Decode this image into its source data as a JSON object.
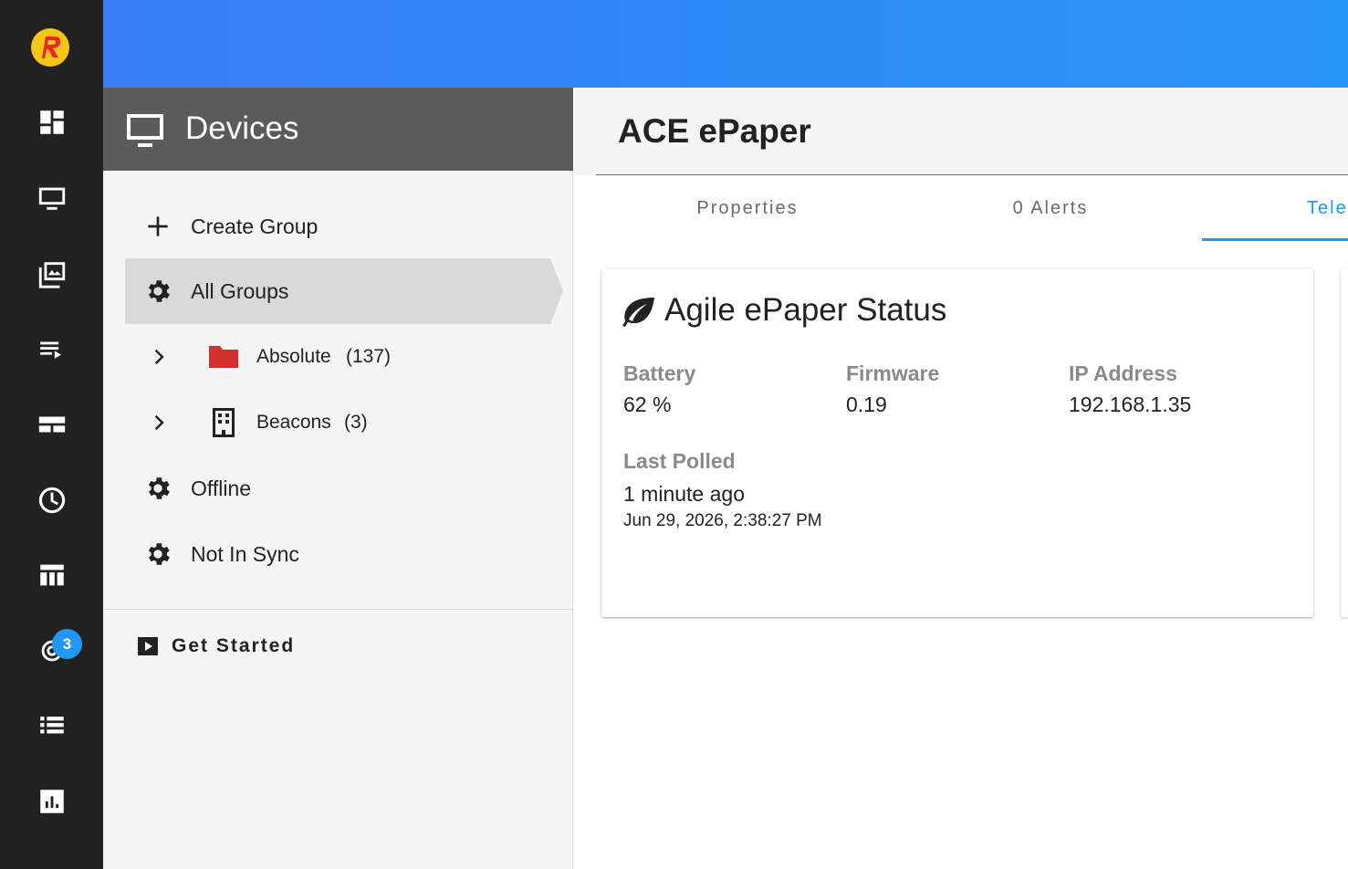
{
  "rail": {
    "badge_count": "3"
  },
  "devices_panel": {
    "title": "Devices",
    "create_group": "Create Group",
    "all_groups": "All Groups",
    "groups": [
      {
        "label": "Absolute",
        "count": "(137)"
      },
      {
        "label": "Beacons",
        "count": "(3)"
      }
    ],
    "offline": "Offline",
    "not_in_sync": "Not In Sync",
    "get_started": "Get Started"
  },
  "main": {
    "device_name": "ACE ePaper",
    "tabs": [
      {
        "label": "Properties"
      },
      {
        "label": "0 Alerts"
      },
      {
        "label": "Telemetry"
      }
    ],
    "status_card": {
      "title": "Agile ePaper Status",
      "battery_label": "Battery",
      "battery_value": "62 %",
      "firmware_label": "Firmware",
      "firmware_value": "0.19",
      "ip_label": "IP Address",
      "ip_value": "192.168.1.35",
      "last_polled_label": "Last Polled",
      "last_polled_relative": "1 minute ago",
      "last_polled_timestamp": "Jun 29, 2026, 2:38:27 PM"
    }
  },
  "colors": {
    "rail_bg": "#212121",
    "accent": "#2196f3",
    "header_gray": "#5b5b5b",
    "topbar_blue": "#2e8cf6"
  }
}
